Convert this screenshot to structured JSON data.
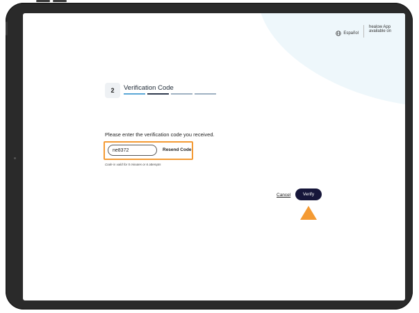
{
  "header": {
    "language_label": "Español",
    "app_label": "healow App available on"
  },
  "step": {
    "number": "2",
    "title": "Verification Code",
    "progress_colors": [
      "#5aa7d6",
      "#2f3b4f",
      "#9fb1c2",
      "#9fb1c2"
    ]
  },
  "form": {
    "prompt": "Please enter the verification code you received.",
    "code_value": "ne8372",
    "resend_label": "Resend Code",
    "validity_note": "Code is valid for 5 minutes or 6 attempts"
  },
  "actions": {
    "cancel_label": "Cancel",
    "verify_label": "Verify"
  },
  "colors": {
    "accent_orange": "#f49a33",
    "primary_button": "#16163a"
  }
}
